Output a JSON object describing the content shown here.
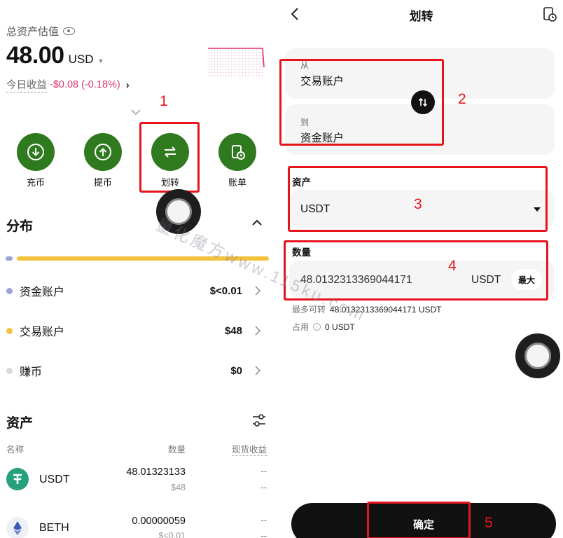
{
  "left": {
    "total_label": "总资产估值",
    "balance": "48.00",
    "currency": "USD",
    "pnl_label": "今日收益",
    "pnl_value": "-$0.08 (-0.18%)",
    "actions": [
      {
        "label": "充币",
        "icon": "deposit-icon"
      },
      {
        "label": "提币",
        "icon": "withdraw-icon"
      },
      {
        "label": "划转",
        "icon": "transfer-icon"
      },
      {
        "label": "账单",
        "icon": "bill-icon"
      }
    ],
    "distribution_title": "分布",
    "accounts": [
      {
        "name": "资金账户",
        "value": "$<0.01",
        "color": "#9aa3d8"
      },
      {
        "name": "交易账户",
        "value": "$48",
        "color": "#f2c23c"
      },
      {
        "name": "赚币",
        "value": "$0",
        "color": "#d9d9d9"
      }
    ],
    "assets_title": "资产",
    "headers": {
      "name": "名称",
      "qty": "数量",
      "pnl": "现货收益"
    },
    "assets": [
      {
        "symbol": "USDT",
        "qty": "48.01323133",
        "value": "$48",
        "pnl": "--",
        "icon": "tether-icon"
      },
      {
        "symbol": "BETH",
        "qty": "0.00000059",
        "value": "$<0.01",
        "pnl": "--",
        "icon": "ethereum-icon"
      }
    ]
  },
  "right": {
    "title": "划转",
    "from_label": "从",
    "from_value": "交易账户",
    "to_label": "到",
    "to_value": "资金账户",
    "asset_label": "资产",
    "asset_value": "USDT",
    "qty_label": "数量",
    "qty_value": "48.0132313369044171",
    "qty_unit": "USDT",
    "max_label": "最大",
    "max_transfer_label": "最多可转",
    "max_transfer_value": "48.0132313369044171 USDT",
    "occupied_label": "占用",
    "occupied_value": "0 USDT",
    "confirm_label": "确定"
  },
  "annotations": [
    "1",
    "2",
    "3",
    "4",
    "5"
  ],
  "watermark": "量化魔方www.115ku.com",
  "colors": {
    "accent_green": "#2f7a1e",
    "annotation_red": "#e5141d",
    "loss_pink": "#d83a6b"
  }
}
